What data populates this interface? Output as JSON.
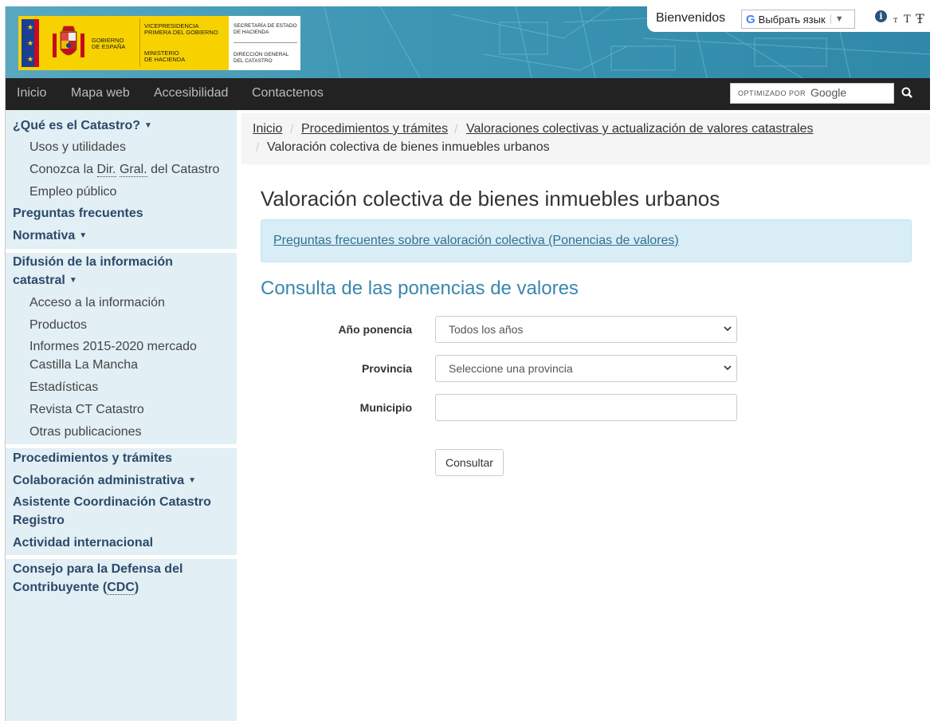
{
  "header": {
    "logo": {
      "gov_line1": "GOBIERNO",
      "gov_line2": "DE ESPAÑA",
      "vice_line1": "VICEPRESIDENCIA",
      "vice_line2": "PRIMERA DEL GOBIERNO",
      "min_line1": "MINISTERIO",
      "min_line2": "DE HACIENDA",
      "sec_line1": "SECRETARÍA DE ESTADO",
      "sec_line2": "DE HACIENDA",
      "dir_line1": "DIRECCIÓN GENERAL",
      "dir_line2": "DEL CATASTRO"
    },
    "welcome": "Bienvenidos",
    "language_select": "Выбрать язык",
    "language_arrow": "▼",
    "info_icon_glyph": "i",
    "text_small_glyph": "т",
    "text_medium_glyph": "T",
    "text_large_glyph": "Ŧ"
  },
  "nav": {
    "items": [
      "Inicio",
      "Mapa web",
      "Accesibilidad",
      "Contactenos"
    ],
    "search_optimized": "OPTIMIZADO POR",
    "search_brand": "Google"
  },
  "sidebar": {
    "que_es": "¿Qué es el Catastro?",
    "usos": "Usos y utilidades",
    "conozca_pre": "Conozca la ",
    "conozca_abbr1": "Dir.",
    "conozca_abbr2": "Gral.",
    "conozca_post": " del Catastro",
    "empleo": "Empleo público",
    "preguntas": "Preguntas frecuentes",
    "normativa": "Normativa",
    "difusion_1": "Difusión de la información",
    "difusion_2": "catastral",
    "acceso": "Acceso a la información",
    "productos": "Productos",
    "informes_1": "Informes 2015-2020 mercado",
    "informes_2": "Castilla La Mancha",
    "estadisticas": "Estadísticas",
    "revista": "Revista CT Catastro",
    "otras": "Otras publicaciones",
    "procedimientos": "Procedimientos y trámites",
    "colaboracion": "Colaboración administrativa",
    "asistente_1": "Asistente Coordinación Catastro",
    "asistente_2": "Registro",
    "actividad": "Actividad internacional",
    "consejo_1": "Consejo para la Defensa del",
    "consejo_2_pre": "Contribuyente (",
    "consejo_2_abbr": "CDC",
    "consejo_2_post": ")",
    "caret": "▼"
  },
  "breadcrumb": {
    "inicio": "Inicio",
    "procedimientos": "Procedimientos y trámites",
    "valoraciones": "Valoraciones colectivas y actualización de valores catastrales",
    "current": "Valoración colectiva de bienes inmuebles urbanos",
    "sep": "/"
  },
  "main": {
    "title": "Valoración colectiva de bienes inmuebles urbanos",
    "faq_link": "Preguntas frecuentes sobre valoración colectiva (Ponencias de valores)",
    "subtitle": "Consulta de las ponencias de valores",
    "form": {
      "anio_label": "Año ponencia",
      "anio_value": "Todos los años",
      "provincia_label": "Provincia",
      "provincia_value": "Seleccione una provincia",
      "municipio_label": "Municipio",
      "municipio_value": "",
      "submit": "Consultar"
    }
  },
  "colors": {
    "header_bg": "#3b95b3",
    "nav_bg": "#222222",
    "sidebar_bg": "#e2eff4",
    "accent_heading": "#3a87ad",
    "alert_bg": "#d9edf7"
  }
}
